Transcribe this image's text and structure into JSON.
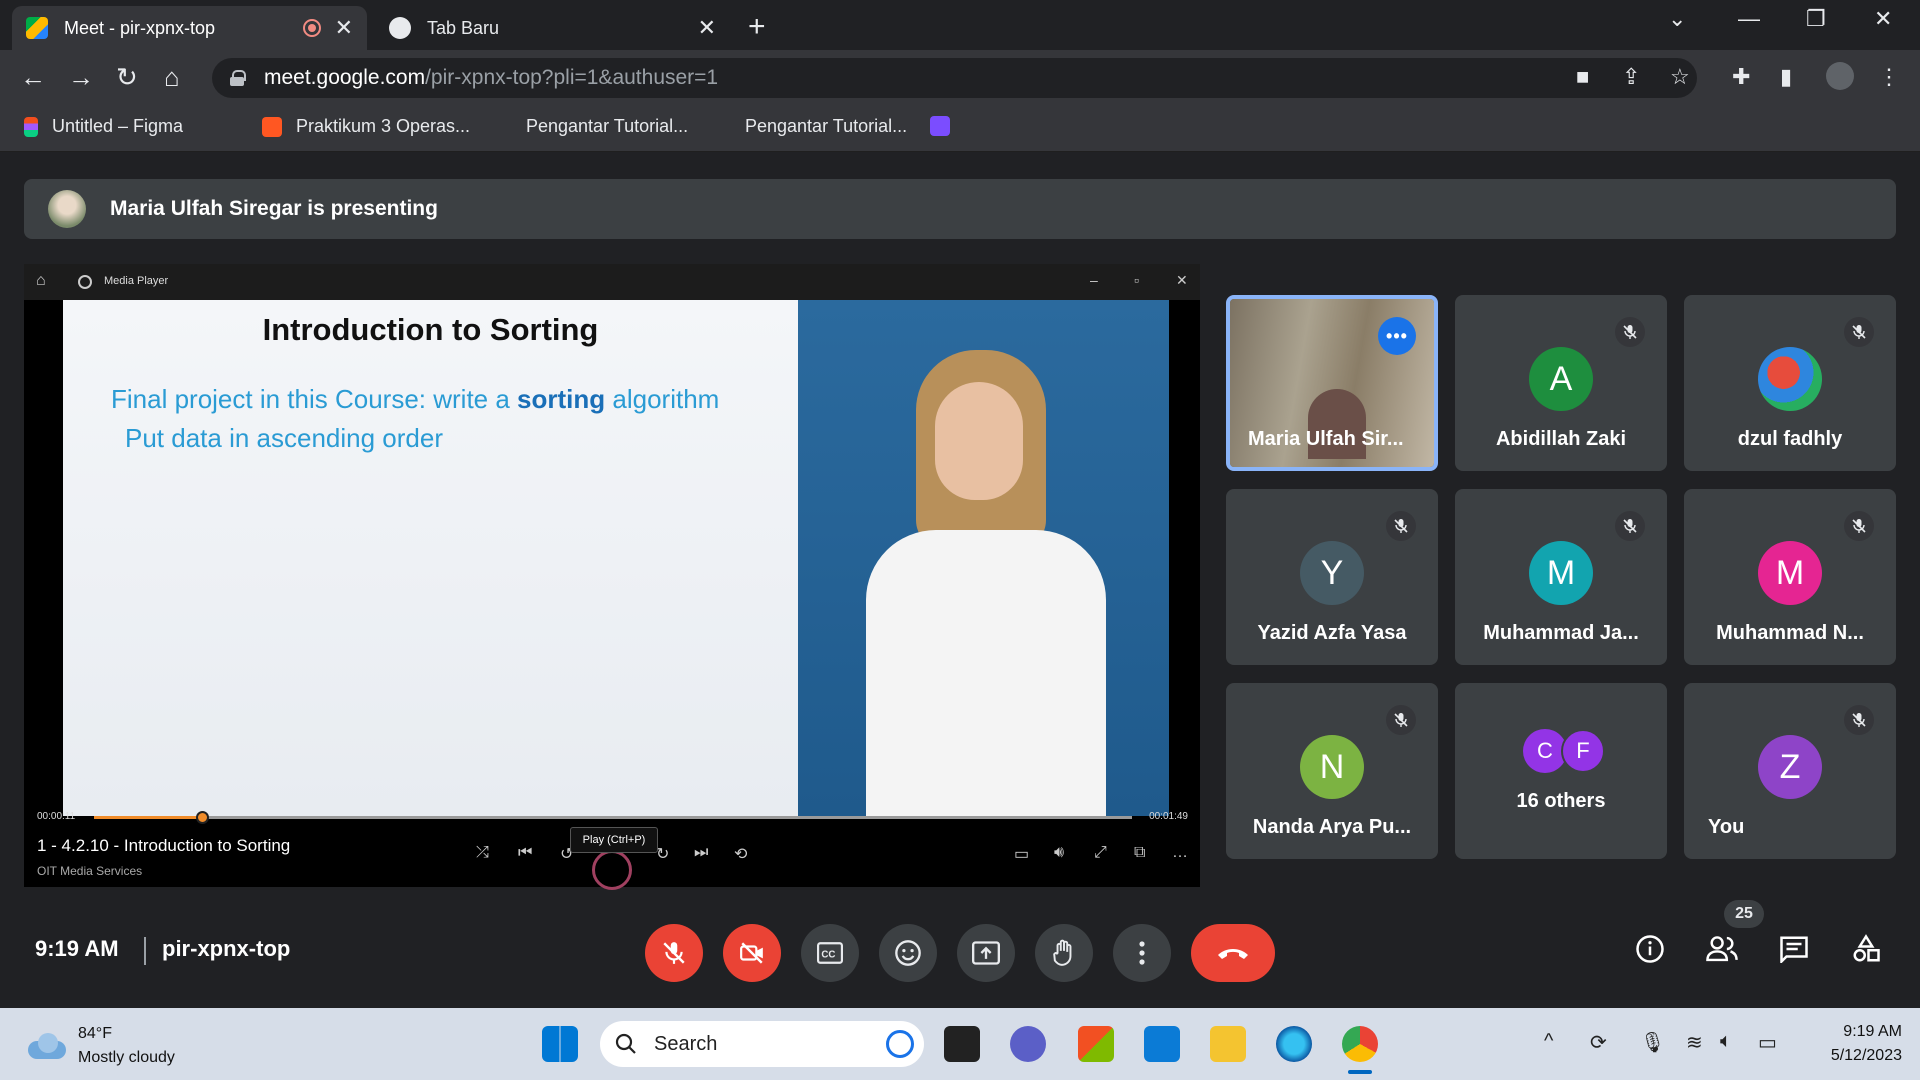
{
  "browser": {
    "tabs": [
      {
        "title": "Meet - pir-xpnx-top",
        "active": true,
        "recording": true
      },
      {
        "title": "Tab Baru",
        "active": false
      }
    ],
    "url_host": "meet.google.com",
    "url_path": "/pir-xpnx-top?pli=1&authuser=1",
    "bookmarks": [
      "Untitled – Figma",
      "Praktikum 3 Operas...",
      "Pengantar Tutorial...",
      "Pengantar Tutorial..."
    ]
  },
  "meet": {
    "banner": "Maria Ulfah Siregar is presenting",
    "media_player": {
      "window_title": "Media Player",
      "slide_title": "Introduction to Sorting",
      "slide_line1_pre": "Final project in this Course: write a ",
      "slide_line1_bold": "sorting",
      "slide_line1_post": " algorithm",
      "slide_line2": "Put data in ascending order",
      "time_current": "00:00:11",
      "time_total": "00:01:49",
      "progress": 0.104,
      "track_title": "1 - 4.2.10 - Introduction to Sorting",
      "track_source": "OIT Media Services",
      "tooltip": "Play (Ctrl+P)"
    },
    "participants": [
      {
        "name": "Maria Ulfah Sir...",
        "type": "video",
        "speaking": true
      },
      {
        "name": "Abidillah Zaki",
        "initial": "A",
        "color": "#1e8e3e",
        "muted": true
      },
      {
        "name": "dzul fadhly",
        "initial": "",
        "color": "#ffffff",
        "muted": true,
        "photo": true
      },
      {
        "name": "Yazid Azfa Yasa",
        "initial": "Y",
        "color": "#455a64",
        "muted": true
      },
      {
        "name": "Muhammad Ja...",
        "initial": "M",
        "color": "#12a4af",
        "muted": true
      },
      {
        "name": "Muhammad N...",
        "initial": "M",
        "color": "#e52592",
        "muted": true
      },
      {
        "name": "Nanda Arya Pu...",
        "initial": "N",
        "color": "#7cb342",
        "muted": true
      },
      {
        "name": "16 others",
        "others": [
          "C",
          "F"
        ],
        "others_colors": [
          "#9334e6",
          "#9334e6"
        ]
      },
      {
        "name": "You",
        "initial": "Z",
        "color": "#8e44c8",
        "muted": true
      }
    ],
    "clock": "9:19 AM",
    "meeting_code": "pir-xpnx-top",
    "people_count": "25"
  },
  "taskbar": {
    "temperature": "84°F",
    "weather": "Mostly cloudy",
    "search_placeholder": "Search",
    "time": "9:19 AM",
    "date": "5/12/2023"
  },
  "colors": {
    "accent": "#8ab4f8",
    "danger": "#ea4335"
  }
}
